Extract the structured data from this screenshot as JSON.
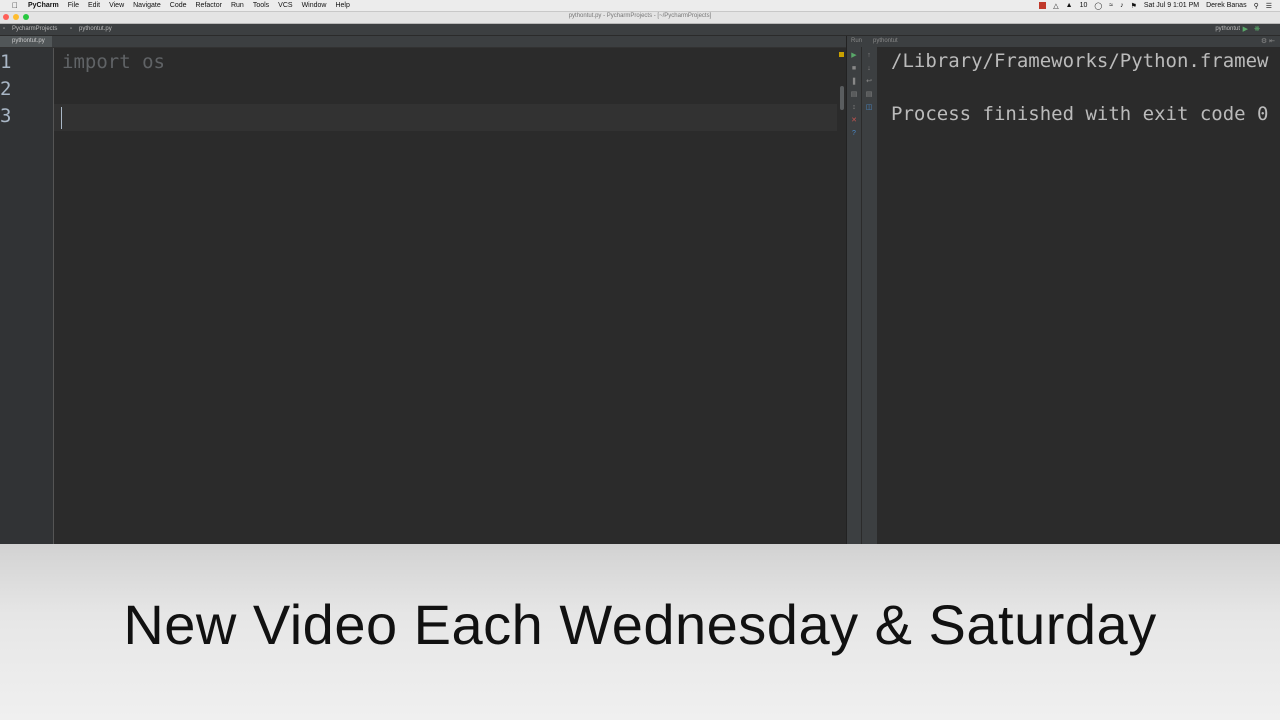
{
  "menubar": {
    "app_name": "PyCharm",
    "items": [
      "File",
      "Edit",
      "View",
      "Navigate",
      "Code",
      "Refactor",
      "Run",
      "Tools",
      "VCS",
      "Window",
      "Help"
    ],
    "status_count": "10",
    "datetime": "Sat Jul 9  1:01 PM",
    "user": "Derek Banas"
  },
  "window": {
    "title": "pythontut.py - PycharmProjects - [~/PycharmProjects]"
  },
  "navbar": {
    "project": "PycharmProjects",
    "file": "pythontut.py",
    "run_config": "pythontut"
  },
  "editor": {
    "tab_label": "pythontut.py",
    "lines": [
      {
        "number": "1",
        "code": "import os"
      },
      {
        "number": "2",
        "code": ""
      },
      {
        "number": "3",
        "code": ""
      }
    ]
  },
  "run_panel": {
    "header_label": "Run",
    "config_label": "pythontut",
    "output_lines": [
      "/Library/Frameworks/Python.framew",
      "",
      "Process finished with exit code 0"
    ]
  },
  "banner": {
    "text": "New Video Each Wednesday & Saturday"
  },
  "colors": {
    "editor_bg": "#2b2b2b",
    "gutter_bg": "#313335",
    "run_green": "#59a869",
    "stop_red": "#c75450"
  }
}
